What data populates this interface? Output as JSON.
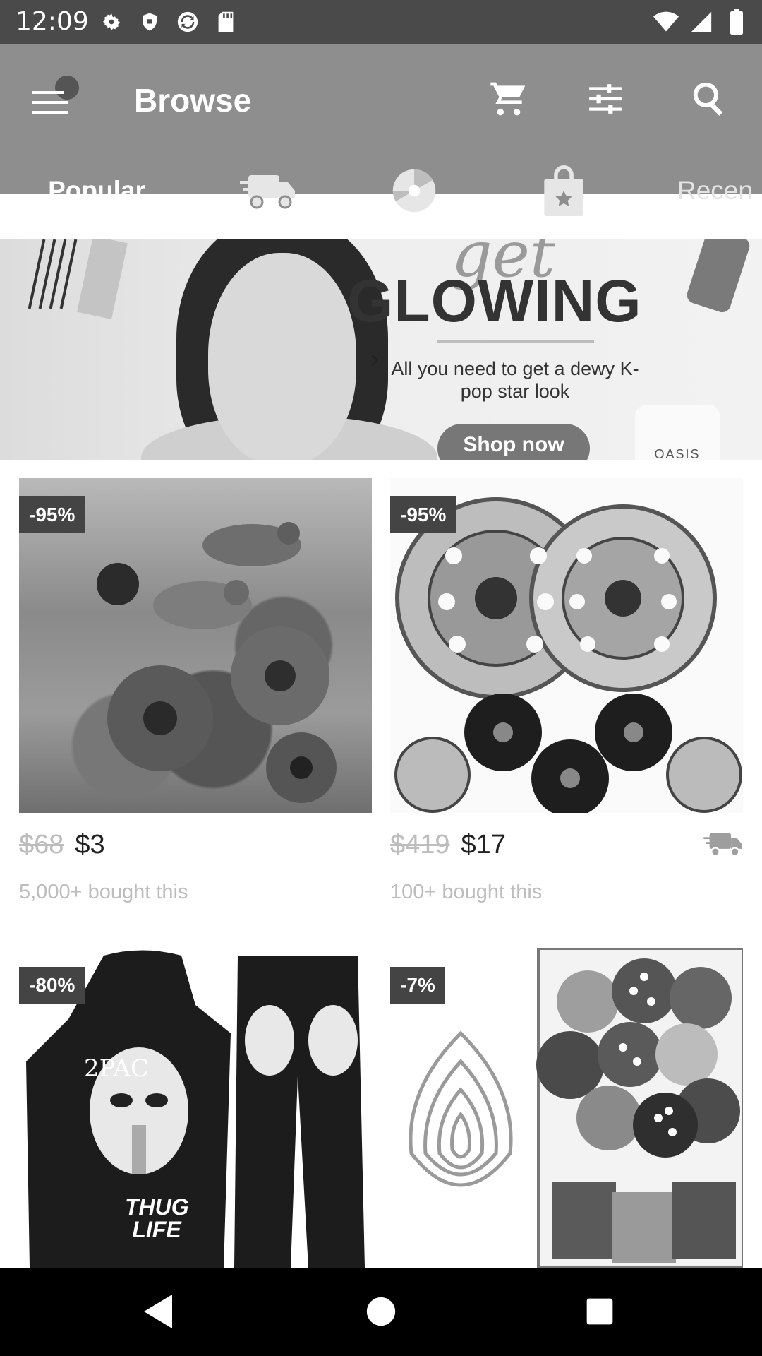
{
  "status": {
    "time": "12:09",
    "left_icons": [
      "gear-icon",
      "shield-icon",
      "sync-icon",
      "sd-card-icon"
    ],
    "right_icons": [
      "wifi-icon",
      "signal-icon",
      "battery-icon"
    ]
  },
  "app_bar": {
    "title": "Browse",
    "actions": [
      "cart-icon",
      "filter-icon",
      "search-icon"
    ]
  },
  "tabs": [
    {
      "label": "Popular",
      "selected": true
    },
    {
      "icon": "truck-icon"
    },
    {
      "icon": "spinner-icon"
    },
    {
      "icon": "shopping-bag-star-icon"
    },
    {
      "label": "Recen"
    }
  ],
  "banner": {
    "script": "get",
    "headline": "GLOWING",
    "subtitle": "All you need to get a dewy K-pop star look",
    "button": "Shop now",
    "jar_label": "OASIS"
  },
  "products": [
    {
      "badge": "-95%",
      "old_price": "$68",
      "price": "$3",
      "bought": "5,000+ bought this",
      "fast_shipping": false
    },
    {
      "badge": "-95%",
      "old_price": "$419",
      "price": "$17",
      "bought": "100+ bought this",
      "fast_shipping": true
    },
    {
      "badge": "-80%",
      "hood_text": "2PAC",
      "thug": "THUG LIFE"
    },
    {
      "badge": "-7%"
    }
  ],
  "colors": {
    "status_bar": "#4a4a4a",
    "app_bar": "#8e8e8e",
    "badge": "#444444",
    "muted_text": "#bdbdbd"
  }
}
